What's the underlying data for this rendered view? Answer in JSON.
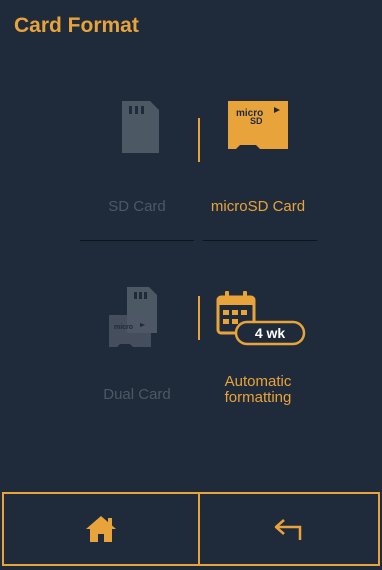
{
  "header": {
    "title": "Card Format"
  },
  "options": {
    "sd_card": {
      "label": "SD Card",
      "state": "inactive"
    },
    "microsd_card": {
      "label": "microSD Card",
      "state": "active"
    },
    "dual_card": {
      "label": "Dual Card",
      "state": "inactive"
    },
    "auto_format": {
      "label_line1": "Automatic",
      "label_line2": "formatting",
      "badge": "4 wk",
      "state": "active"
    }
  },
  "icons": {
    "sd": "sd-card-icon",
    "microsd": "microsd-card-icon",
    "dual": "dual-card-icon",
    "calendar": "calendar-icon",
    "home": "home-icon",
    "back": "back-arrow-icon"
  },
  "colors": {
    "accent": "#e8a33a",
    "background": "#1f2b3a",
    "inactive": "#4d5865"
  }
}
